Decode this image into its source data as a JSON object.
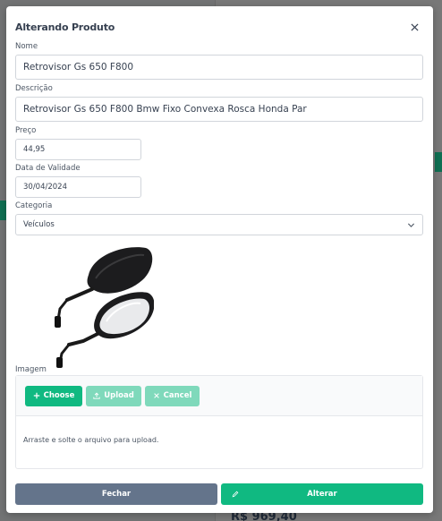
{
  "background": {
    "price_text": "R$ 969,40"
  },
  "dialog": {
    "title": "Alterando Produto",
    "close_icon": "close-icon",
    "fields": {
      "nome": {
        "label": "Nome",
        "value": "Retrovisor Gs 650 F800"
      },
      "descricao": {
        "label": "Descrição",
        "value": "Retrovisor Gs 650 F800 Bmw Fixo Convexa Rosca Honda Par"
      },
      "preco": {
        "label": "Preço",
        "value": "44,95"
      },
      "validade": {
        "label": "Data de Validade",
        "value": "30/04/2024"
      },
      "categoria": {
        "label": "Categoria",
        "value": "Veículos"
      }
    },
    "imagem": {
      "label": "Imagem",
      "choose_label": "Choose",
      "upload_label": "Upload",
      "cancel_label": "Cancel",
      "dropzone_text": "Arraste e solte o arquivo para upload."
    },
    "footer": {
      "close_label": "Fechar",
      "save_label": "Alterar"
    }
  },
  "colors": {
    "primary": "#10b981",
    "primary_disabled": "#7fd9bb",
    "secondary": "#64748b"
  }
}
